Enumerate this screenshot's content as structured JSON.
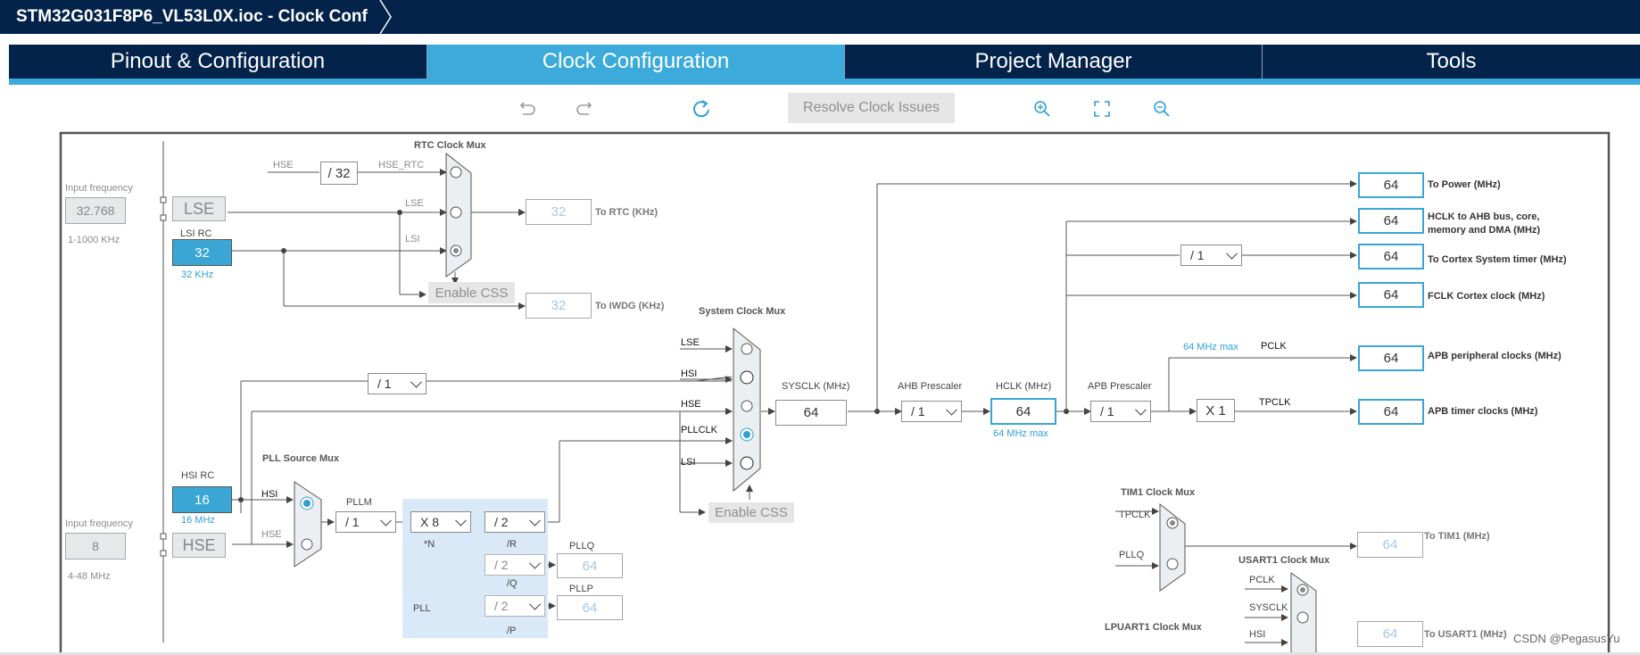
{
  "window": {
    "title": "STM32G031F8P6_VL53L0X.ioc - Clock Conf"
  },
  "tabs": [
    {
      "label": "Pinout & Configuration"
    },
    {
      "label": "Clock Configuration"
    },
    {
      "label": "Project Manager"
    },
    {
      "label": "Tools"
    }
  ],
  "toolbar": {
    "resolve_label": "Resolve Clock Issues"
  },
  "colors": {
    "navy": "#03234b",
    "accent": "#3cabdc"
  },
  "left": {
    "input_frequency_label": "Input frequency",
    "lse_freq": "32.768",
    "lse_range": "1-1000 KHz",
    "lse_label": "LSE",
    "lsi_rc_label": "LSI RC",
    "lsi_value": "32",
    "lsi_unit": "32 KHz",
    "hsi_rc_label": "HSI RC",
    "hsi_value": "16",
    "hsi_unit": "16 MHz",
    "hse_input_label": "Input frequency",
    "hse_freq": "8",
    "hse_range": "4-48 MHz",
    "hse_label": "HSE"
  },
  "rtc": {
    "mux_title": "RTC Clock Mux",
    "hse_label": "HSE",
    "div": "/ 32",
    "hse_rtc_label": "HSE_RTC",
    "lse_label": "LSE",
    "lsi_label": "LSI",
    "out_value": "32",
    "out_label": "To RTC (KHz)",
    "css_label": "Enable CSS",
    "iwdg_value": "32",
    "iwdg_label": "To IWDG (KHz)"
  },
  "sysmux": {
    "title": "System Clock Mux",
    "inputs": [
      "LSE",
      "HSI",
      "HSE",
      "PLLCLK",
      "LSI"
    ],
    "hsi_div": "/ 1",
    "css_label": "Enable CSS"
  },
  "pll": {
    "source_title": "PLL Source Mux",
    "hsi_label": "HSI",
    "hse_label": "HSE",
    "pllm_label": "PLLM",
    "pllm": "/ 1",
    "n": "X 8",
    "n_label": "*N",
    "r": "/ 2",
    "r_label": "/R",
    "q": "/ 2",
    "q_label": "/Q",
    "p": "/ 2",
    "p_label": "/P",
    "pllq_label": "PLLQ",
    "pllq_value": "64",
    "pllp_label": "PLLP",
    "pllp_value": "64",
    "pll_label": "PLL"
  },
  "main": {
    "sysclk_label": "SYSCLK (MHz)",
    "sysclk": "64",
    "ahb_label": "AHB Prescaler",
    "ahb": "/ 1",
    "hclk_label": "HCLK (MHz)",
    "hclk": "64",
    "hclk_max": "64 MHz max",
    "apb_label": "APB Prescaler",
    "apb": "/ 1",
    "pclk_max": "64 MHz max",
    "pclk_label": "PCLK",
    "x1": "X 1",
    "tpclk_label": "TPCLK",
    "cortex_div": "/ 1"
  },
  "outputs": [
    {
      "value": "64",
      "label": "To Power (MHz)"
    },
    {
      "value": "64",
      "label": "HCLK to AHB bus, core,",
      "label2": "memory and DMA (MHz)"
    },
    {
      "value": "64",
      "label": "To Cortex System timer (MHz)"
    },
    {
      "value": "64",
      "label": "FCLK Cortex clock (MHz)"
    },
    {
      "value": "64",
      "label": "APB peripheral clocks (MHz)"
    },
    {
      "value": "64",
      "label": "APB timer clocks (MHz)"
    }
  ],
  "tim1": {
    "title": "TIM1 Clock Mux",
    "in1": "TPCLK",
    "in2": "PLLQ",
    "value": "64",
    "label": "To TIM1 (MHz)"
  },
  "usart1": {
    "title": "USART1 Clock Mux",
    "in1": "PCLK",
    "in2": "SYSCLK",
    "in3": "HSI",
    "value": "64",
    "label": "To USART1 (MHz)"
  },
  "lpuart": {
    "title": "LPUART1 Clock Mux"
  },
  "watermark": "CSDN @PegasusYu"
}
